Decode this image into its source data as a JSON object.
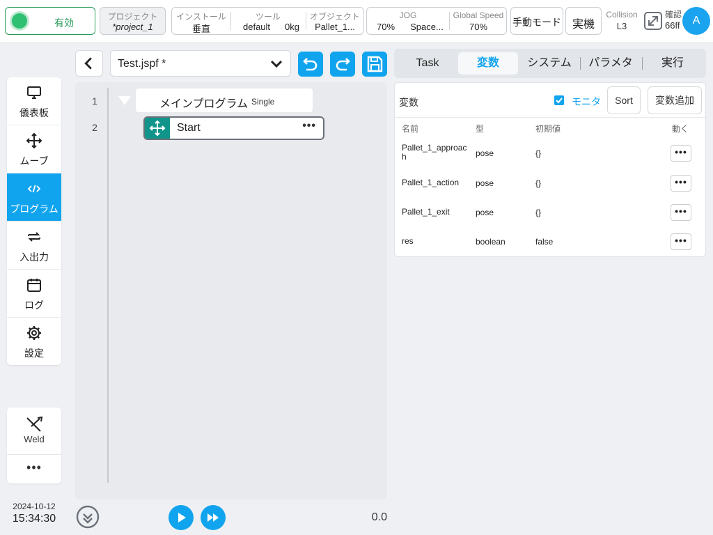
{
  "topbar": {
    "enable_label": "有効",
    "project": {
      "label": "プロジェクト",
      "value": "*project_1"
    },
    "install": {
      "label": "インストール",
      "value": "垂直"
    },
    "tool": {
      "label": "ツール",
      "name": "default",
      "weight": "0kg"
    },
    "object": {
      "label": "オブジェクト",
      "value": "Pallet_1..."
    },
    "jog": {
      "label": "JOG",
      "percent": "70%",
      "mode": "Space..."
    },
    "global_speed": {
      "label": "Global Speed",
      "value": "70%"
    },
    "manual_mode": "手動モード",
    "real_machine": "実機",
    "collision": {
      "label": "Collision",
      "value": "L3"
    },
    "confirm": {
      "label": "確認",
      "value": "66ff"
    },
    "avatar": "A"
  },
  "sidebar": {
    "items": [
      {
        "label": "儀表板",
        "icon": "monitor-icon"
      },
      {
        "label": "ムーブ",
        "icon": "move-icon"
      },
      {
        "label": "プログラム",
        "icon": "code-icon"
      },
      {
        "label": "入出力",
        "icon": "swap-icon"
      },
      {
        "label": "ログ",
        "icon": "calendar-icon"
      },
      {
        "label": "設定",
        "icon": "gear-icon"
      }
    ],
    "active_index": 2,
    "weld": {
      "label": "Weld",
      "icon": "weld-icon"
    },
    "more": "•••",
    "date": "2024-10-12",
    "time": "15:34:30"
  },
  "program": {
    "file_name": "Test.jspf *",
    "lines": [
      {
        "number": "1",
        "label": "メインプログラム",
        "sub": "Single"
      },
      {
        "number": "2",
        "label": "Start"
      }
    ],
    "node_more": "•••",
    "speed_value": "0.0"
  },
  "tabs": [
    {
      "label": "Task"
    },
    {
      "label": "変数"
    },
    {
      "label": "システム"
    },
    {
      "label": "パラメタ"
    },
    {
      "label": "実行"
    }
  ],
  "active_tab": 1,
  "variables": {
    "title": "変数",
    "monitor_label": "モニタ",
    "monitor_checked": true,
    "sort_label": "Sort",
    "add_label": "変数追加",
    "columns": {
      "name": "名前",
      "type": "型",
      "initial": "初期値",
      "action": "動く"
    },
    "rows": [
      {
        "name": "Pallet_1_approach",
        "type": "pose",
        "initial": "{}"
      },
      {
        "name": "Pallet_1_action",
        "type": "pose",
        "initial": "{}"
      },
      {
        "name": "Pallet_1_exit",
        "type": "pose",
        "initial": "{}"
      },
      {
        "name": "res",
        "type": "boolean",
        "initial": "false"
      }
    ],
    "row_more": "•••"
  },
  "colors": {
    "accent": "#11a4ee",
    "enabled": "#2fc072",
    "node_teal": "#11958a"
  }
}
